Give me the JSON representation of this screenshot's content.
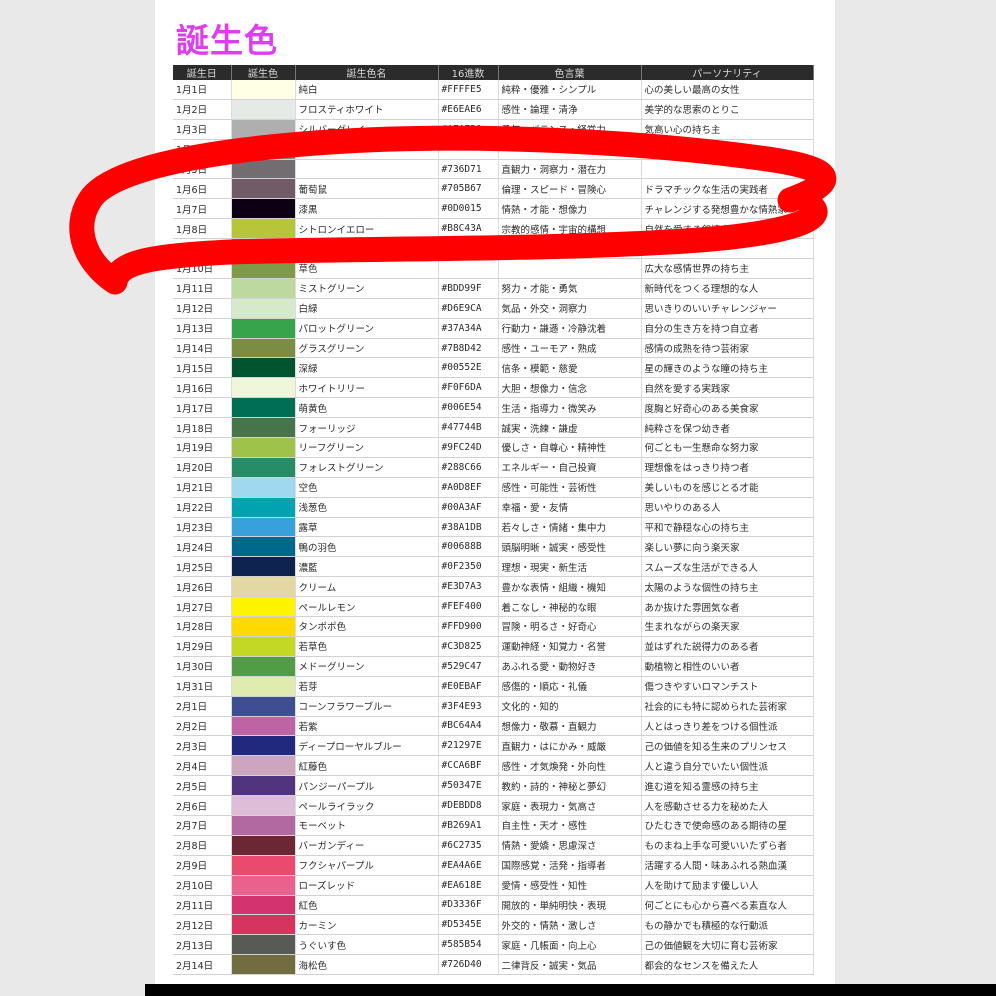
{
  "title": "誕生色",
  "columns": [
    "誕生日",
    "誕生色",
    "誕生色名",
    "16進数",
    "色言葉",
    "パーソナリティ"
  ],
  "marker_color": "#ff0000",
  "rows": [
    {
      "date": "1月1日",
      "color": "#FFFFE5",
      "name": "純白",
      "hex": "#FFFFE5",
      "words": "純粋・優雅・シンプル",
      "personality": "心の美しい最高の女性"
    },
    {
      "date": "1月2日",
      "color": "#E6EAE6",
      "name": "フロスティホワイト",
      "hex": "#E6EAE6",
      "words": "感性・論理・清浄",
      "personality": "美学的な思索のとりこ"
    },
    {
      "date": "1月3日",
      "color": "#AFAFB0",
      "name": "シルバーグレイ",
      "hex": "#AFAFB0",
      "words": "勇気・バランス・経営力",
      "personality": "気高い心の持ち主"
    },
    {
      "date": "1月4日",
      "color": "#8A8A8C",
      "name": "",
      "hex": "",
      "words": "",
      "personality": ""
    },
    {
      "date": "1月5日",
      "color": "#736D71",
      "name": "",
      "hex": "#736D71",
      "words": "直観力・洞察力・潜在力",
      "personality": ""
    },
    {
      "date": "1月6日",
      "color": "#705B67",
      "name": "葡萄鼠",
      "hex": "#705B67",
      "words": "倫理・スピード・冒険心",
      "personality": "ドラマチックな生活の実践者"
    },
    {
      "date": "1月7日",
      "color": "#0D0015",
      "name": "漆黒",
      "hex": "#0D0015",
      "words": "情熱・才能・想像力",
      "personality": "チャレンジする発想豊かな情熱家"
    },
    {
      "date": "1月8日",
      "color": "#B8C43A",
      "name": "シトロンイエロー",
      "hex": "#B8C43A",
      "words": "宗教的感情・宇宙的構想",
      "personality": "自然を愛する叙情家"
    },
    {
      "date": "1月9日",
      "color": "#6E8A3C",
      "name": "",
      "hex": "",
      "words": "",
      "personality": ""
    },
    {
      "date": "1月10日",
      "color": "#7F9A48",
      "name": "草色",
      "hex": "",
      "words": "",
      "personality": "広大な感情世界の持ち主"
    },
    {
      "date": "1月11日",
      "color": "#BDD99F",
      "name": "ミストグリーン",
      "hex": "#BDD99F",
      "words": "努力・才能・勇気",
      "personality": "新時代をつくる理想的な人"
    },
    {
      "date": "1月12日",
      "color": "#D6E9CA",
      "name": "白緑",
      "hex": "#D6E9CA",
      "words": "気品・外交・洞察力",
      "personality": "思いきりのいいチャレンジャー"
    },
    {
      "date": "1月13日",
      "color": "#37A34A",
      "name": "パロットグリーン",
      "hex": "#37A34A",
      "words": "行動力・謙遜・冷静沈着",
      "personality": "自分の生き方を持つ自立者"
    },
    {
      "date": "1月14日",
      "color": "#7B8D42",
      "name": "グラスグリーン",
      "hex": "#7B8D42",
      "words": "感性・ユーモア・熟成",
      "personality": "感情の成熟を待つ芸術家"
    },
    {
      "date": "1月15日",
      "color": "#00552E",
      "name": "深緑",
      "hex": "#00552E",
      "words": "信条・模範・慈愛",
      "personality": "星の輝きのような瞳の持ち主"
    },
    {
      "date": "1月16日",
      "color": "#F0F6DA",
      "name": "ホワイトリリー",
      "hex": "#F0F6DA",
      "words": "大胆・想像力・信念",
      "personality": "自然を愛する実践家"
    },
    {
      "date": "1月17日",
      "color": "#006E54",
      "name": "萌黄色",
      "hex": "#006E54",
      "words": "生活・指導力・微笑み",
      "personality": "度胸と好奇心のある美食家"
    },
    {
      "date": "1月18日",
      "color": "#47744B",
      "name": "フォーリッジ",
      "hex": "#47744B",
      "words": "誠実・洗練・謙虚",
      "personality": "純粋さを保つ幼き者"
    },
    {
      "date": "1月19日",
      "color": "#9FC24D",
      "name": "リーフグリーン",
      "hex": "#9FC24D",
      "words": "優しさ・自尊心・精神性",
      "personality": "何ごとも一生懸命な努力家"
    },
    {
      "date": "1月20日",
      "color": "#288C66",
      "name": "フォレストグリーン",
      "hex": "#288C66",
      "words": "エネルギー・自己投資",
      "personality": "理想像をはっきり持つ者"
    },
    {
      "date": "1月21日",
      "color": "#A0D8EF",
      "name": "空色",
      "hex": "#A0D8EF",
      "words": "感性・可能性・芸術性",
      "personality": "美しいものを感じとる才能"
    },
    {
      "date": "1月22日",
      "color": "#00A3AF",
      "name": "浅葱色",
      "hex": "#00A3AF",
      "words": "幸福・愛・友情",
      "personality": "思いやりのある人"
    },
    {
      "date": "1月23日",
      "color": "#38A1DB",
      "name": "露草",
      "hex": "#38A1DB",
      "words": "若々しさ・情緒・集中力",
      "personality": "平和で静穏な心の持ち主"
    },
    {
      "date": "1月24日",
      "color": "#00688B",
      "name": "鴨の羽色",
      "hex": "#00688B",
      "words": "頭脳明晰・誠実・感受性",
      "personality": "楽しい夢に向う楽天家"
    },
    {
      "date": "1月25日",
      "color": "#0F2350",
      "name": "濃藍",
      "hex": "#0F2350",
      "words": "理想・現実・新生活",
      "personality": "スムーズな生活ができる人"
    },
    {
      "date": "1月26日",
      "color": "#E3D7A3",
      "name": "クリーム",
      "hex": "#E3D7A3",
      "words": "豊かな表情・組織・機知",
      "personality": "太陽のような個性の持ち主"
    },
    {
      "date": "1月27日",
      "color": "#FEF400",
      "name": "ペールレモン",
      "hex": "#FEF400",
      "words": "着こなし・神秘的な眼",
      "personality": "あか抜けた雰囲気な者"
    },
    {
      "date": "1月28日",
      "color": "#FFD900",
      "name": "タンポポ色",
      "hex": "#FFD900",
      "words": "冒険・明るさ・好奇心",
      "personality": "生まれながらの楽天家"
    },
    {
      "date": "1月29日",
      "color": "#C3D825",
      "name": "若草色",
      "hex": "#C3D825",
      "words": "運動神経・知覚力・名誉",
      "personality": "並はずれた説得力のある者"
    },
    {
      "date": "1月30日",
      "color": "#529C47",
      "name": "メドーグリーン",
      "hex": "#529C47",
      "words": "あふれる愛・動物好き",
      "personality": "動植物と相性のいい者"
    },
    {
      "date": "1月31日",
      "color": "#E0EBAF",
      "name": "若芽",
      "hex": "#E0EBAF",
      "words": "感傷的・順応・礼儀",
      "personality": "傷つきやすいロマンチスト"
    },
    {
      "date": "2月1日",
      "color": "#3F4E93",
      "name": "コーンフラワーブルー",
      "hex": "#3F4E93",
      "words": "文化的・知的",
      "personality": "社会的にも特に認められた芸術家"
    },
    {
      "date": "2月2日",
      "color": "#BC64A4",
      "name": "若紫",
      "hex": "#BC64A4",
      "words": "想像力・敬慕・直観力",
      "personality": "人とはっきり差をつける個性派"
    },
    {
      "date": "2月3日",
      "color": "#21297E",
      "name": "ディープローヤルブルー",
      "hex": "#21297E",
      "words": "直観力・はにかみ・威厳",
      "personality": "己の価値を知る生来のプリンセス"
    },
    {
      "date": "2月4日",
      "color": "#CCA6BF",
      "name": "紅藤色",
      "hex": "#CCA6BF",
      "words": "感性・才気煥発・外向性",
      "personality": "人と違う自分でいたい個性派"
    },
    {
      "date": "2月5日",
      "color": "#50347E",
      "name": "パンジーパープル",
      "hex": "#50347E",
      "words": "教約・詩的・神秘と夢幻",
      "personality": "進む道を知る霊感の持ち主"
    },
    {
      "date": "2月6日",
      "color": "#DEBDD8",
      "name": "ペールライラック",
      "hex": "#DEBDD8",
      "words": "家庭・表現力・気高さ",
      "personality": "人を感動させる力を秘めた人"
    },
    {
      "date": "2月7日",
      "color": "#B269A1",
      "name": "モーベット",
      "hex": "#B269A1",
      "words": "自主性・天才・感性",
      "personality": "ひたむきで使命感のある期待の星"
    },
    {
      "date": "2月8日",
      "color": "#6C2735",
      "name": "バーガンディー",
      "hex": "#6C2735",
      "words": "情熱・愛嬌・思慮深さ",
      "personality": "ものまね上手な可愛いいたずら者"
    },
    {
      "date": "2月9日",
      "color": "#EA4A6E",
      "name": "フクシャパープル",
      "hex": "#EA4A6E",
      "words": "国際感覚・活発・指導者",
      "personality": "活躍する人間・味あふれる熱血漢"
    },
    {
      "date": "2月10日",
      "color": "#EA618E",
      "name": "ローズレッド",
      "hex": "#EA618E",
      "words": "愛情・感受性・知性",
      "personality": "人を助けて励ます優しい人"
    },
    {
      "date": "2月11日",
      "color": "#D3336F",
      "name": "紅色",
      "hex": "#D3336F",
      "words": "開放的・単純明快・表現",
      "personality": "何ごとにも心から喜べる素直な人"
    },
    {
      "date": "2月12日",
      "color": "#D5345E",
      "name": "カーミン",
      "hex": "#D5345E",
      "words": "外交的・情熱・激しさ",
      "personality": "もの静かでも積極的な行動派"
    },
    {
      "date": "2月13日",
      "color": "#585B54",
      "name": "うぐいす色",
      "hex": "#585B54",
      "words": "家庭・几帳面・向上心",
      "personality": "己の価値観を大切に育む芸術家"
    },
    {
      "date": "2月14日",
      "color": "#726D40",
      "name": "海松色",
      "hex": "#726D40",
      "words": "二律背反・誠実・気品",
      "personality": "都会的なセンスを備えた人"
    }
  ]
}
